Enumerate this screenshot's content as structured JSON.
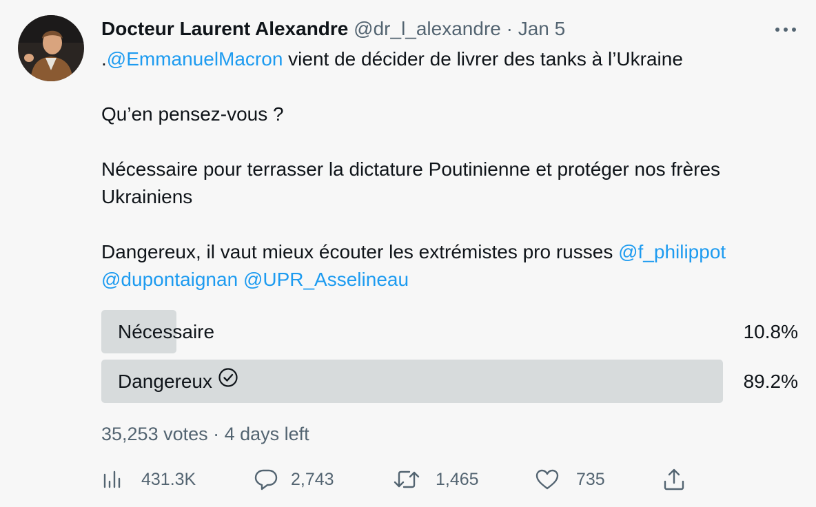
{
  "author": {
    "name": "Docteur Laurent Alexandre",
    "handle": "@dr_l_alexandre",
    "separator": "·",
    "date": "Jan 5"
  },
  "tweet": {
    "line1_prefix": ".",
    "line1_mention": "@EmmanuelMacron",
    "line1_rest": " vient de décider de livrer des tanks à l’Ukraine",
    "question": "Qu’en pensez-vous ?",
    "option1_text": "Nécessaire pour terrasser la dictature Poutinienne et protéger nos frères Ukrainiens",
    "option2_text": "Dangereux, il vaut mieux écouter les extrémistes pro russes ",
    "option2_mention1": "@f_philippot",
    "option2_mention2": "@dupontaignan",
    "option2_mention3": "@UPR_Asselineau"
  },
  "poll": {
    "options": [
      {
        "label": "Nécessaire",
        "percent_text": "10.8%",
        "fraction": 0.108,
        "winner": false
      },
      {
        "label": "Dangereux",
        "percent_text": "89.2%",
        "fraction": 0.892,
        "winner": true
      }
    ],
    "footer": "35,253 votes · 4 days left"
  },
  "actions": {
    "views": "431.3K",
    "replies": "2,743",
    "retweets": "1,465",
    "likes": "735"
  },
  "colors": {
    "link": "#1d9bf0",
    "secondary_text": "#536471",
    "poll_bar": "#d7dbdc",
    "background": "#f7f7f7"
  },
  "icons": [
    "more-icon",
    "check-circle-icon",
    "views-icon",
    "reply-icon",
    "retweet-icon",
    "like-icon",
    "share-icon"
  ]
}
